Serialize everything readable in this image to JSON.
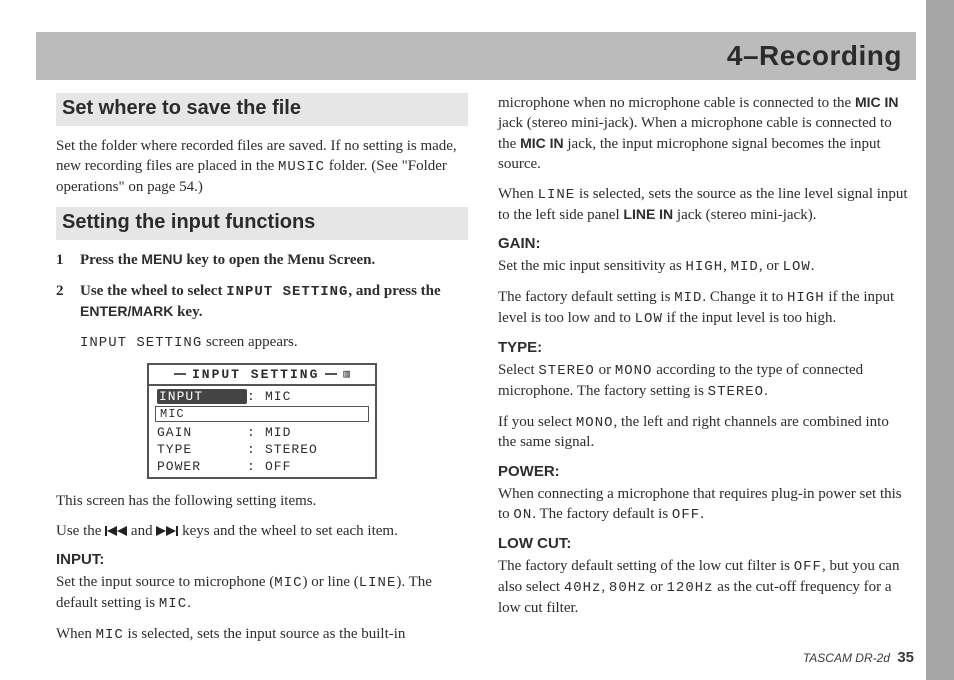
{
  "header": {
    "title": "4–Recording"
  },
  "left": {
    "section1": {
      "heading": "Set where to save the file",
      "para1_a": "Set the folder where recorded files are saved. If no setting is made, new recording files are placed in the ",
      "para1_mono": "MUSIC",
      "para1_b": " folder. (See \"Folder operations\" on page 54.)"
    },
    "section2": {
      "heading": "Setting the input functions",
      "step1_a": "Press the ",
      "step1_key": "MENU",
      "step1_b": " key to open the Menu Screen.",
      "step2_a": "Use the wheel to select ",
      "step2_mono": "INPUT SETTING",
      "step2_b": ", and press the ",
      "step2_key": "ENTER/MARK",
      "step2_c": " key.",
      "step2_note_a": "INPUT SETTING",
      "step2_note_b": " screen appears.",
      "lcd": {
        "title": "INPUT  SETTING",
        "rows": [
          {
            "k": "INPUT",
            "v": "MIC",
            "selected": true
          },
          {
            "sub": "MIC"
          },
          {
            "k": "GAIN",
            "v": "MID"
          },
          {
            "k": "TYPE",
            "v": "STEREO"
          },
          {
            "k": "POWER",
            "v": "OFF"
          }
        ]
      },
      "after1": "This screen has the following setting items.",
      "after2_a": "Use the ",
      "after2_b": " and ",
      "after2_c": " keys and the wheel to set each item.",
      "input_h": "INPUT:",
      "input_p1_a": "Set the input source to microphone (",
      "input_p1_m1": "MIC",
      "input_p1_b": ") or line (",
      "input_p1_m2": "LINE",
      "input_p1_c": "). The default setting is ",
      "input_p1_m3": "MIC",
      "input_p1_d": ".",
      "input_p2_a": "When ",
      "input_p2_m": "MIC",
      "input_p2_b": " is selected, sets the input source as the built-in"
    }
  },
  "right": {
    "top_p1_a": "microphone when no microphone cable is connected to the ",
    "top_p1_key": "MIC IN",
    "top_p1_b": " jack (stereo mini-jack). When a microphone cable is connected to the ",
    "top_p1_key2": "MIC IN",
    "top_p1_c": " jack, the input microphone signal becomes the input source.",
    "top_p2_a": "When ",
    "top_p2_m": "LINE",
    "top_p2_b": " is selected, sets the source as the line level signal input to the left side panel ",
    "top_p2_key": "LINE IN",
    "top_p2_c": " jack (stereo mini-jack).",
    "gain_h": "GAIN:",
    "gain_p1_a": "Set the mic input sensitivity as ",
    "gain_p1_m1": "HIGH",
    "gain_p1_m2": "MID",
    "gain_p1_m3": "LOW",
    "gain_p2_a": "The factory default setting is ",
    "gain_p2_m1": "MID",
    "gain_p2_b": ". Change it to ",
    "gain_p2_m2": "HIGH",
    "gain_p2_c": " if the input level is too low and to ",
    "gain_p2_m3": "LOW",
    "gain_p2_d": " if the input level is too high.",
    "type_h": "TYPE:",
    "type_p1_a": "Select ",
    "type_p1_m1": "STEREO",
    "type_p1_b": " or ",
    "type_p1_m2": "MONO",
    "type_p1_c": " according to the type of connected microphone. The factory setting is ",
    "type_p1_m3": "STEREO",
    "type_p2_a": "If you select ",
    "type_p2_m": "MONO",
    "type_p2_b": ", the left and right channels are combined into the same signal.",
    "power_h": "POWER:",
    "power_p_a": "When connecting a microphone that requires plug-in power set this to ",
    "power_p_m1": "ON",
    "power_p_b": ". The factory default is ",
    "power_p_m2": "OFF",
    "lowcut_h": "LOW CUT:",
    "lowcut_p_a": "The factory default setting of the low cut filter is ",
    "lowcut_p_m1": "OFF",
    "lowcut_p_b": ", but you can also select ",
    "lowcut_p_m2": "40Hz",
    "lowcut_p_m3": "80Hz",
    "lowcut_p_m4": "120Hz",
    "lowcut_p_c": " as the cut-off frequency for a low cut filter."
  },
  "footer": {
    "product": "TASCAM  DR-2d",
    "page": "35"
  }
}
